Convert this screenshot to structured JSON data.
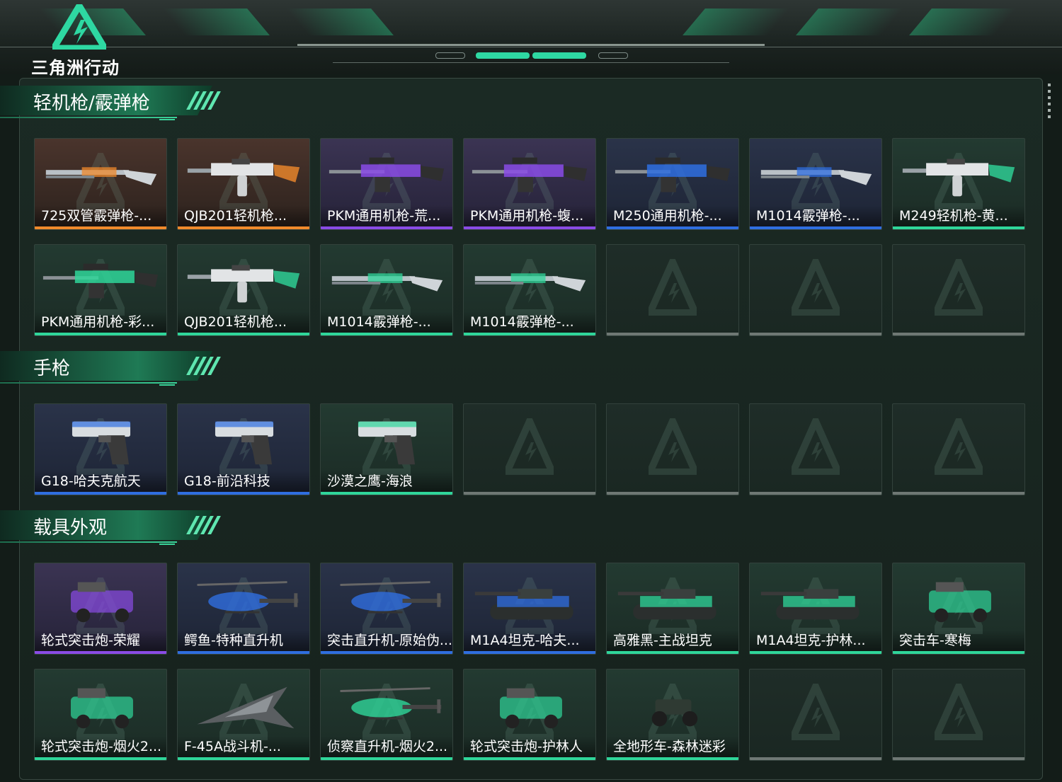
{
  "header": {
    "logo_text": "三角洲行动"
  },
  "sections": [
    {
      "title": "轻机枪/霰弹枪",
      "items": [
        {
          "label": "725双管霰弹枪-...",
          "rarity": "orange",
          "icon": "shotgun-icon"
        },
        {
          "label": "QJB201轻机枪...",
          "rarity": "orange",
          "icon": "lmg-icon"
        },
        {
          "label": "PKM通用机枪-荒...",
          "rarity": "purple",
          "icon": "machine-gun-icon"
        },
        {
          "label": "PKM通用机枪-蝮...",
          "rarity": "purple",
          "icon": "machine-gun-icon"
        },
        {
          "label": "M250通用机枪-...",
          "rarity": "blue",
          "icon": "machine-gun-icon"
        },
        {
          "label": "M1014霰弹枪-...",
          "rarity": "blue",
          "icon": "shotgun-icon"
        },
        {
          "label": "M249轻机枪-黄...",
          "rarity": "green",
          "icon": "lmg-icon"
        },
        {
          "label": "PKM通用机枪-彩...",
          "rarity": "green",
          "icon": "machine-gun-icon"
        },
        {
          "label": "QJB201轻机枪...",
          "rarity": "green",
          "icon": "lmg-icon"
        },
        {
          "label": "M1014霰弹枪-...",
          "rarity": "green",
          "icon": "shotgun-icon"
        },
        {
          "label": "M1014霰弹枪-...",
          "rarity": "green",
          "icon": "shotgun-icon"
        },
        null,
        null,
        null
      ]
    },
    {
      "title": "手枪",
      "items": [
        {
          "label": "G18-哈夫克航天",
          "rarity": "blue",
          "icon": "pistol-icon"
        },
        {
          "label": "G18-前沿科技",
          "rarity": "blue",
          "icon": "pistol-icon"
        },
        {
          "label": "沙漠之鹰-海浪",
          "rarity": "green",
          "icon": "pistol-icon"
        },
        null,
        null,
        null,
        null
      ]
    },
    {
      "title": "载具外观",
      "items": [
        {
          "label": "轮式突击炮-荣耀",
          "rarity": "purple",
          "icon": "armored-car-icon"
        },
        {
          "label": "鳄鱼-特种直升机",
          "rarity": "blue",
          "icon": "helicopter-icon"
        },
        {
          "label": "突击直升机-原始伪...",
          "rarity": "blue",
          "icon": "helicopter-icon"
        },
        {
          "label": "M1A4坦克-哈夫...",
          "rarity": "blue",
          "icon": "tank-icon"
        },
        {
          "label": "高雅黑-主战坦克",
          "rarity": "green",
          "icon": "tank-icon"
        },
        {
          "label": "M1A4坦克-护林...",
          "rarity": "green",
          "icon": "tank-icon"
        },
        {
          "label": "突击车-寒梅",
          "rarity": "green",
          "icon": "armored-car-icon"
        },
        {
          "label": "轮式突击炮-烟火2...",
          "rarity": "green",
          "icon": "armored-car-icon"
        },
        {
          "label": "F-45A战斗机-...",
          "rarity": "green",
          "icon": "jet-icon"
        },
        {
          "label": "侦察直升机-烟火2...",
          "rarity": "green",
          "icon": "helicopter-icon"
        },
        {
          "label": "轮式突击炮-护林人",
          "rarity": "green",
          "icon": "armored-car-icon"
        },
        {
          "label": "全地形车-森林迷彩",
          "rarity": "green",
          "icon": "atv-icon"
        },
        null,
        null
      ]
    }
  ],
  "colors": {
    "orange": "#f08a2c",
    "purple": "#8a4be6",
    "blue": "#2f6ee0",
    "green": "#2fd69a",
    "empty": "#6f7874",
    "accent": "#2ed8a2"
  }
}
